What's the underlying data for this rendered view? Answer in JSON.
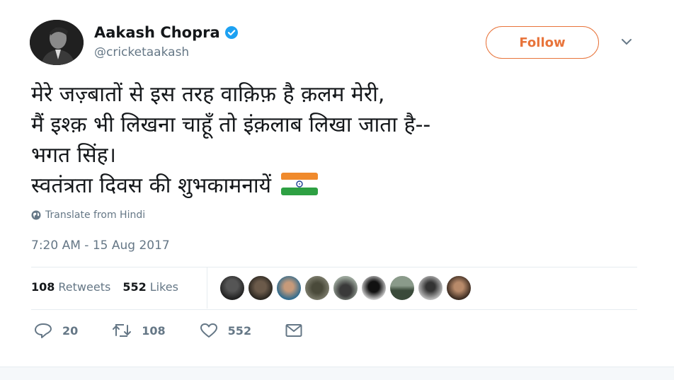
{
  "user": {
    "name": "Aakash Chopra",
    "handle": "@cricketaakash",
    "verified_color": "#1da1f2"
  },
  "follow_button": {
    "label": "Follow",
    "color": "#e8743b"
  },
  "tweet": {
    "lines": [
      "मेरे जज़्बातों से इस तरह वाक़िफ़ है क़लम मेरी,",
      "मैं इश्क़ भी लिखना चाहूँ तो इंक़लाब लिखा जाता है--",
      "भगत सिंह।",
      "स्वतंत्रता दिवस की शुभकामनायें"
    ],
    "emoji": "india-flag"
  },
  "translate_label": "Translate from Hindi",
  "timestamp": "7:20 AM - 15 Aug 2017",
  "stats": {
    "retweets_count": "108",
    "retweets_label": "Retweets",
    "likes_count": "552",
    "likes_label": "Likes"
  },
  "liked_by_avatars": 9,
  "actions": {
    "reply_count": "20",
    "retweet_count": "108",
    "like_count": "552"
  },
  "icons": [
    "verified-icon",
    "chevron-down-icon",
    "globe-icon",
    "reply-icon",
    "retweet-icon",
    "heart-icon",
    "mail-icon"
  ]
}
